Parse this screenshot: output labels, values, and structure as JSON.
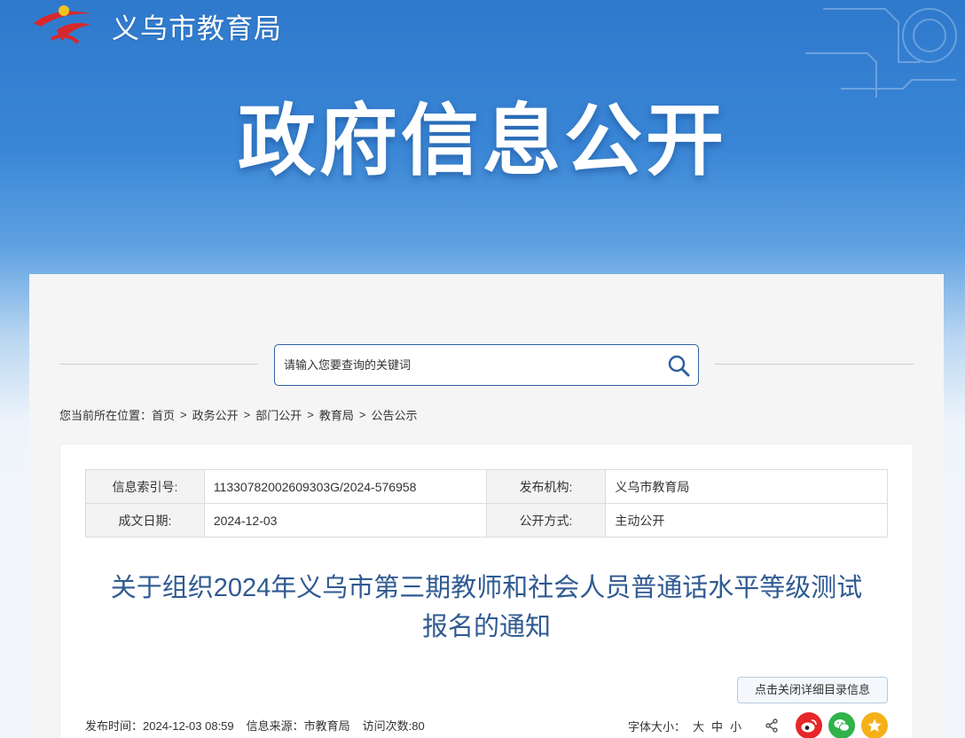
{
  "site": {
    "name": "义乌市教育局"
  },
  "hero": {
    "title": "政府信息公开"
  },
  "search": {
    "placeholder": "请输入您要查询的关键词"
  },
  "breadcrumb": {
    "prefix": "您当前所在位置：",
    "items": [
      "首页",
      "政务公开",
      "部门公开",
      "教育局",
      "公告公示"
    ],
    "separator": ">"
  },
  "meta": {
    "index_label": "信息索引号:",
    "index_value": "11330782002609303G/2024-576958",
    "org_label": "发布机构:",
    "org_value": "义乌市教育局",
    "date_label": "成文日期:",
    "date_value": "2024-12-03",
    "mode_label": "公开方式:",
    "mode_value": "主动公开"
  },
  "article": {
    "title_line1": "关于组织2024年义乌市第三期教师和社会人员普通话水平等级测试",
    "title_line2": "报名的通知",
    "toggle_label": "点击关闭详细目录信息",
    "publish_time": "发布时间：2024-12-03 08:59",
    "source": "信息来源：市教育局",
    "visits": "访问次数:80",
    "font_size_label": "字体大小：",
    "font_sizes": [
      "大",
      "中",
      "小"
    ]
  },
  "icons": {
    "logo": "yiwu-education-logo",
    "search": "search-icon",
    "share": "share-icon",
    "weibo": "weibo-icon",
    "wechat": "wechat-icon",
    "favorite": "star-icon"
  },
  "colors": {
    "banner_top": "#2f79cc",
    "title_blue": "#2f5a92",
    "weibo_red": "#e6262a",
    "wechat_green": "#2fb34a",
    "star_yellow": "#f5b117"
  }
}
